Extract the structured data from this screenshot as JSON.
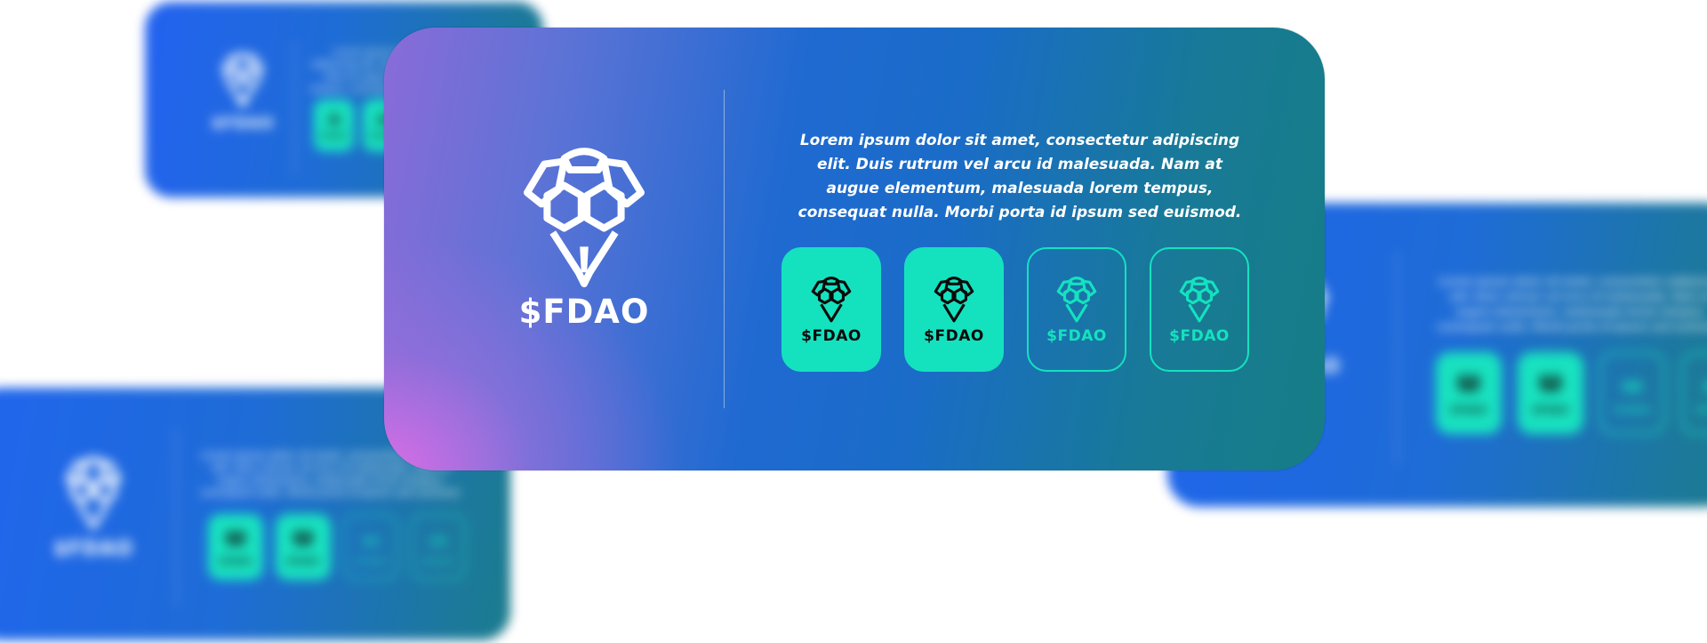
{
  "brand": {
    "name": "$FDAO",
    "logo_icon": "skull-hexagon-icon"
  },
  "main_card": {
    "description": "Lorem ipsum dolor sit amet, consectetur adipiscing elit. Duis rutrum vel arcu id malesuada. Nam at augue elementum, malesuada lorem tempus, consequat nulla. Morbi porta id ipsum sed euismod.",
    "tiles": [
      {
        "label": "$FDAO",
        "variant": "solid"
      },
      {
        "label": "$FDAO",
        "variant": "solid"
      },
      {
        "label": "$FDAO",
        "variant": "outline"
      },
      {
        "label": "$FDAO",
        "variant": "outline"
      }
    ]
  },
  "colors": {
    "accent": "#14e2bf",
    "card_blue": "#1a6ad6",
    "card_teal": "#177a8a",
    "card_pink": "#d66ee0",
    "text": "#ffffff"
  }
}
